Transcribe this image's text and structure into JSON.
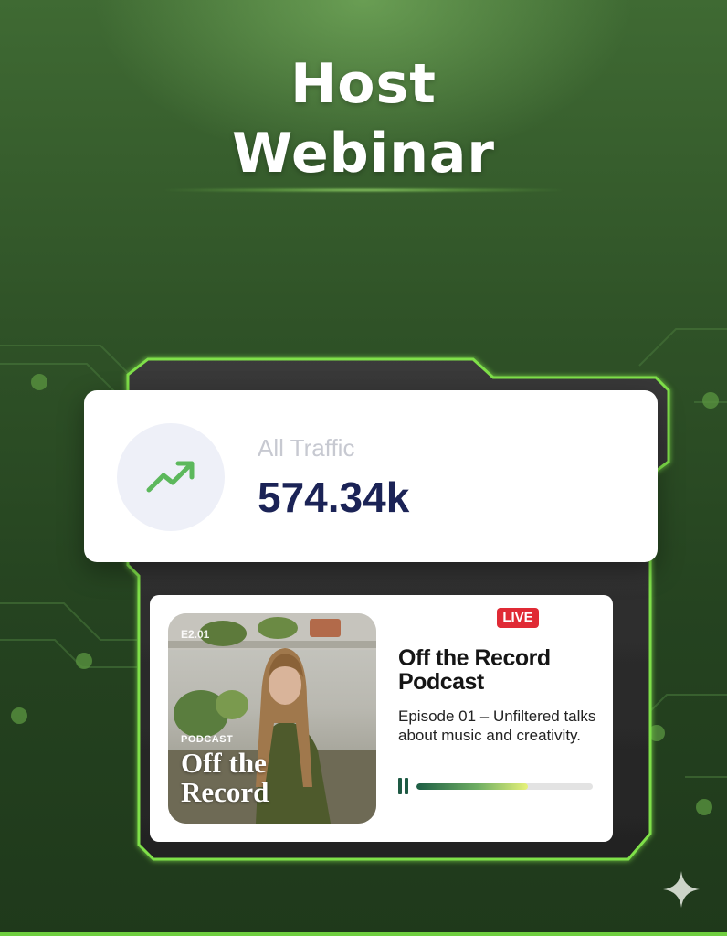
{
  "header": {
    "title_line1": "Host",
    "title_line2": "Webinar"
  },
  "traffic_card": {
    "label": "All Traffic",
    "value": "574.34k",
    "icon": "trending-up-icon"
  },
  "podcast_card": {
    "live_label": "LIVE",
    "cover": {
      "episode_tag": "E2.01",
      "kicker": "PODCAST",
      "title": "Off the Record"
    },
    "title": "Off the Record Podcast",
    "description": "Episode 01 – Unfiltered talks about music and creativity.",
    "progress": 0.63,
    "pause_icon": "pause-icon"
  },
  "colors": {
    "background": "#2f5227",
    "accent_green": "#6fcf3f",
    "value_navy": "#1b2356",
    "live_red": "#e02a35"
  },
  "decoration": {
    "sparkle_icon": "sparkle-icon"
  }
}
